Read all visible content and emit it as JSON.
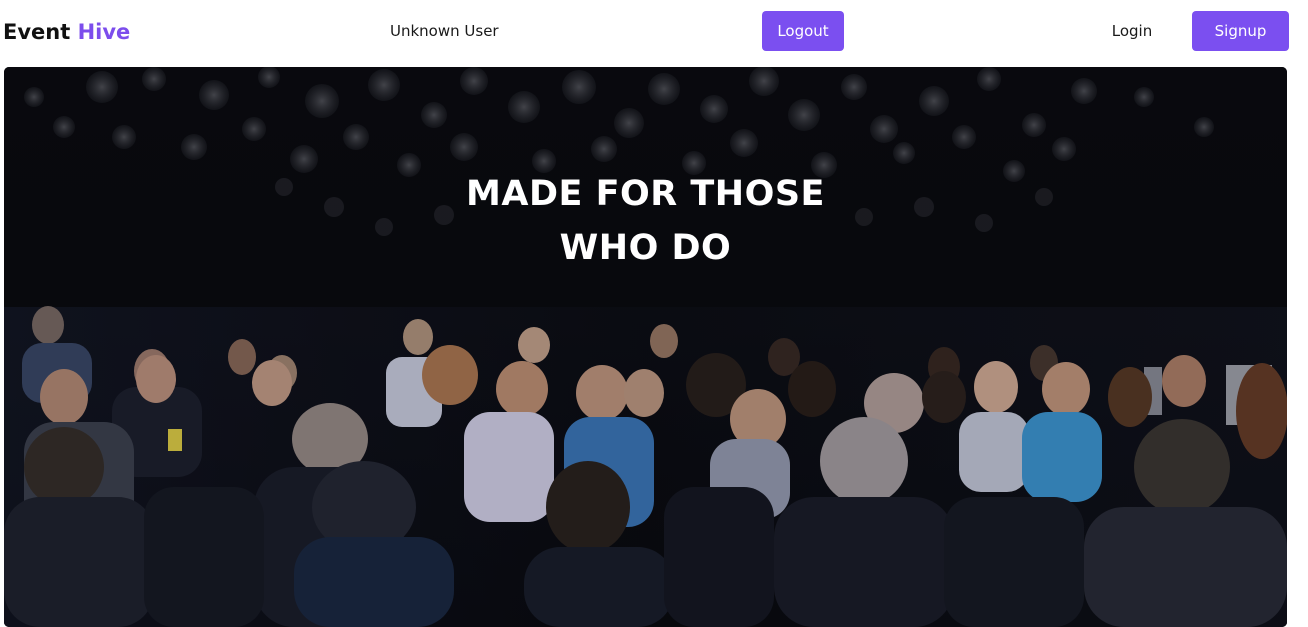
{
  "navbar": {
    "brand_part1": "Event",
    "brand_part2": "Hive",
    "user_name": "Unknown User",
    "logout_label": "Logout",
    "login_label": "Login",
    "signup_label": "Signup"
  },
  "hero": {
    "title_line1": "MADE FOR THOSE",
    "title_line2": "WHO DO",
    "image_subject": "audience seated at a conference event"
  },
  "colors": {
    "accent": "#7b4ff0",
    "hero_background": "#07080d",
    "text": "#111111"
  }
}
